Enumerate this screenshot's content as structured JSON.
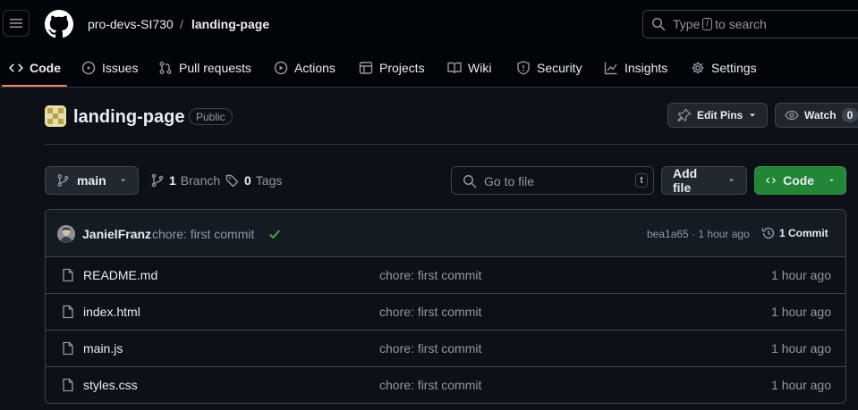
{
  "header": {
    "owner": "pro-devs-SI730",
    "separator": "/",
    "repo": "landing-page",
    "search": {
      "prefix": "Type",
      "key": "/",
      "suffix": "to search"
    }
  },
  "nav": {
    "tabs": [
      {
        "label": "Code",
        "icon": "code-icon",
        "active": true
      },
      {
        "label": "Issues",
        "icon": "issue-icon"
      },
      {
        "label": "Pull requests",
        "icon": "pull-request-icon"
      },
      {
        "label": "Actions",
        "icon": "play-icon"
      },
      {
        "label": "Projects",
        "icon": "table-icon"
      },
      {
        "label": "Wiki",
        "icon": "book-icon"
      },
      {
        "label": "Security",
        "icon": "shield-icon"
      },
      {
        "label": "Insights",
        "icon": "graph-icon"
      },
      {
        "label": "Settings",
        "icon": "gear-icon"
      }
    ]
  },
  "repo_header": {
    "name": "landing-page",
    "visibility": "Public",
    "edit_pins": "Edit Pins",
    "watch": "Watch",
    "watch_count": "0"
  },
  "toolbar": {
    "branch": "main",
    "branch_count": "1",
    "branch_label": "Branch",
    "tag_count": "0",
    "tag_label": "Tags",
    "go_to_file": "Go to file",
    "go_to_file_key": "t",
    "add_file": "Add file",
    "code": "Code"
  },
  "latest_commit": {
    "author": "JanielFranz",
    "message": "chore: first commit",
    "hash_time": "bea1a65 · 1 hour ago",
    "commit_count": "1 Commit"
  },
  "files": [
    {
      "name": "README.md",
      "message": "chore: first commit",
      "time": "1 hour ago"
    },
    {
      "name": "index.html",
      "message": "chore: first commit",
      "time": "1 hour ago"
    },
    {
      "name": "main.js",
      "message": "chore: first commit",
      "time": "1 hour ago"
    },
    {
      "name": "styles.css",
      "message": "chore: first commit",
      "time": "1 hour ago"
    }
  ],
  "colors": {
    "background": "#0d1117",
    "header_background": "#010409",
    "active_tab_underline": "#f78166",
    "code_button": "#238636",
    "success_check": "#3fb950"
  }
}
